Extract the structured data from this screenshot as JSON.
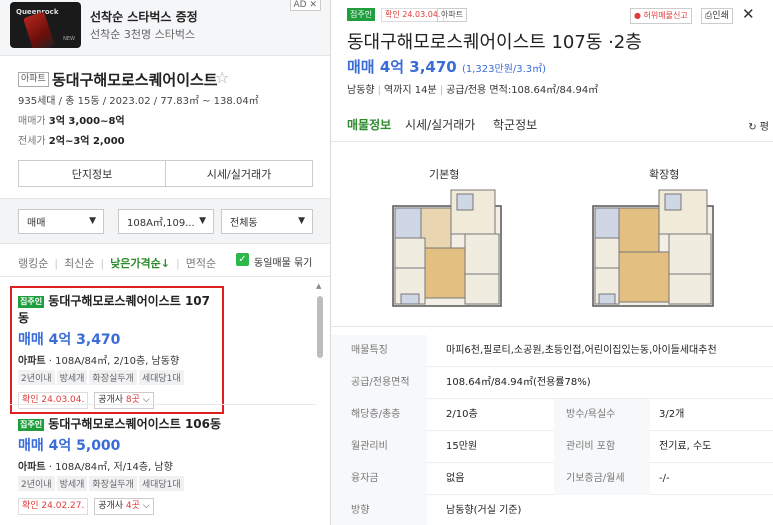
{
  "ad": {
    "title": "선착순 스타벅스 증정",
    "subtitle": "선착순 3천명 스타벅스",
    "badge": "AD ✕",
    "thumb_brand": "Queenrock",
    "thumb_tag": "NEW"
  },
  "complex": {
    "type_tag": "아파트",
    "name": "동대구해모로스퀘어이스트",
    "star_icon": "☆",
    "info": "935세대 / 총 15동 / 2023.02 / 77.83㎡ ~ 138.04㎡",
    "trade_label": "매매가",
    "trade_value": "3억 3,000~8억",
    "lease_label": "전세가",
    "lease_value": "2억~3억 2,000"
  },
  "buttons": {
    "complex_info": "단지정보",
    "market_price": "시세/실거래가"
  },
  "filters": {
    "trade_type": "매매",
    "area": "108A㎡,109...",
    "building": "전체동"
  },
  "sort": {
    "items": [
      "랭킹순",
      "최신순",
      "낮은가격순↓",
      "면적순"
    ],
    "active_index": 2,
    "group_label": "동일매물 묶기"
  },
  "listings": [
    {
      "badge": "집주인",
      "title": "동대구해모로스퀘어이스트 107동",
      "price": "매매 4억 3,470",
      "desc_type": "아파트",
      "desc_rest": " · 108A/84㎡, 2/10층, 남동향",
      "tags": [
        "2년이내",
        "방세개",
        "화장실두개",
        "세대당1대"
      ],
      "confirm": "확인 24.03.04.",
      "agent_label": "공개사",
      "agent_count": "8곳"
    },
    {
      "badge": "집주인",
      "title": "동대구해모로스퀘어이스트 106동",
      "price": "매매 4억 5,000",
      "desc_type": "아파트",
      "desc_rest": " · 108A/84㎡, 저/14층, 남향",
      "tags": [
        "2년이내",
        "방세개",
        "화장실두개",
        "세대당1대"
      ],
      "confirm": "확인 24.02.27.",
      "agent_label": "공개사",
      "agent_count": "4곳"
    }
  ],
  "detail": {
    "tag_owner": "집주인",
    "tag_confirm": "확인 24.03.04.",
    "tag_type": "아파트",
    "report_button": "허위매물신고",
    "print_button": "인쇄",
    "close_icon": "✕",
    "title": "동대구해모로스퀘어이스트 107동 ·2층",
    "price": "매매 4억 3,470",
    "price_per": "(1,323만원/3.3㎡)",
    "meta": [
      "남동향",
      "역까지 14분",
      "공급/전용 면적:108.64㎡/84.94㎡"
    ],
    "tabs": [
      "매물정보",
      "시세/실거래가",
      "학군정보"
    ],
    "active_tab": 0,
    "refresh_label": "평",
    "plans": [
      "기본형",
      "확장형"
    ],
    "rows": [
      {
        "label": "매물특징",
        "value": "마피6천,필로티,소공원,초등인접,어린이집있는동,아이들세대추천"
      },
      {
        "label": "공급/전용면적",
        "value": "108.64㎡/84.94㎡(전용률78%)"
      },
      {
        "label": "해당층/총층",
        "value": "2/10층",
        "label2": "방수/욕실수",
        "value2": "3/2개"
      },
      {
        "label": "월관리비",
        "value": "15만원",
        "label2": "관리비 포함",
        "value2": "전기료, 수도"
      },
      {
        "label": "융자금",
        "value": "없음",
        "label2": "기보증금/월세",
        "value2": "-/-"
      },
      {
        "label": "방향",
        "value": "남동향(거실 기준)"
      }
    ]
  },
  "colors": {
    "accent_green": "#2e8b2e",
    "price_blue": "#3a6cd8",
    "highlight_red": "#e02020"
  }
}
